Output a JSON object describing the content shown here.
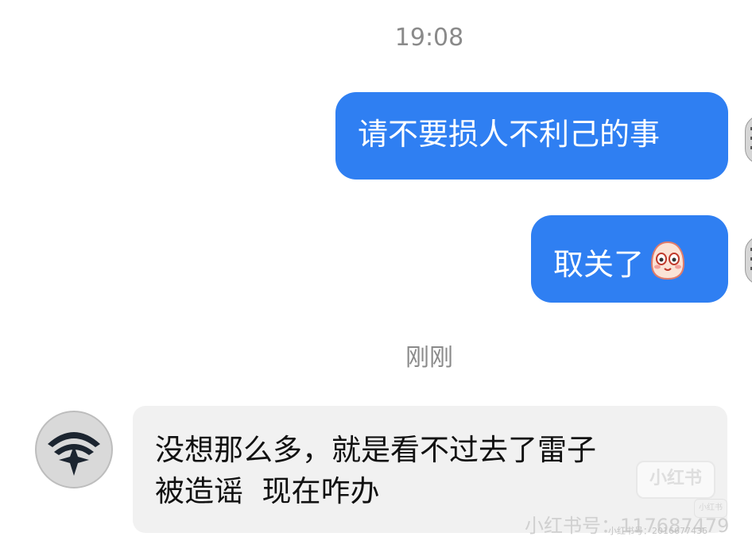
{
  "chat": {
    "timestamp_1": "19:08",
    "timestamp_2": "刚刚",
    "messages": [
      {
        "direction": "outgoing",
        "text": "请不要损人不利己的事"
      },
      {
        "direction": "outgoing",
        "text": "取关了",
        "emoji": "blushing-face-emoji-icon"
      },
      {
        "direction": "incoming",
        "lines": [
          "没想那么多，就是看不过去了雷子",
          "被造谣  现在咋办"
        ]
      }
    ]
  },
  "watermark": {
    "logo": "小红书",
    "logo_small": "小红书",
    "text": "小红书号：117687479",
    "text_small": "小红书号：2016677436"
  },
  "colors": {
    "outgoing_bubble": "#2f7ff2",
    "incoming_bubble": "#f1f1f1",
    "timestamp": "#8a8a8a",
    "background": "#ffffff"
  }
}
